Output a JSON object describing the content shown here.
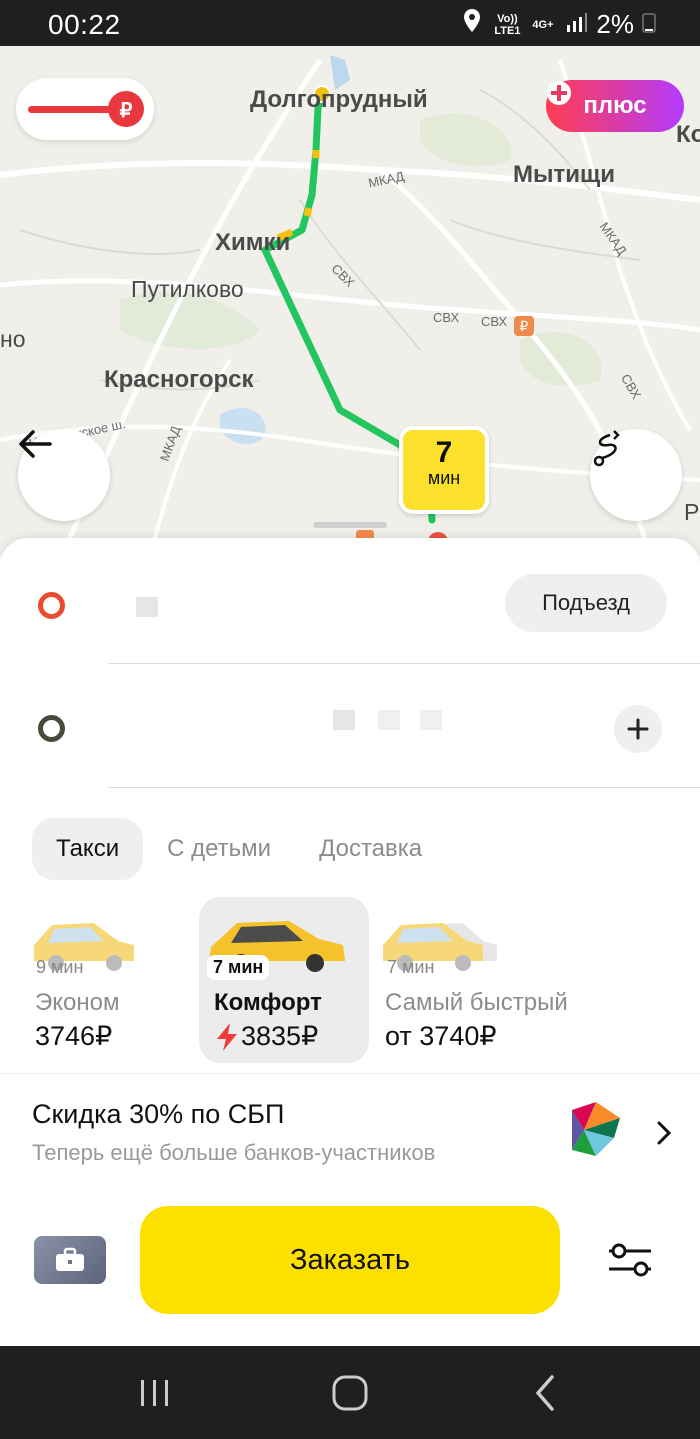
{
  "status_bar": {
    "time": "00:22",
    "network_top": "Vo)) LTE1",
    "network_type": "4G+",
    "battery": "2%"
  },
  "map": {
    "labels": [
      "Долгопрудный",
      "Мытищи",
      "Химки",
      "Путилково",
      "Красногорск",
      "МКАД",
      "МКАД",
      "МКАД",
      "СВХ",
      "СВХ",
      "СВХ",
      "СВХ",
      "Новорижское ш.",
      "Ко",
      "но",
      "Р"
    ],
    "plus_badge": "плюс",
    "eta": {
      "value": "7",
      "unit": "мин"
    },
    "colors": {
      "route": "#22c55e",
      "route_jam": "#f4c10f",
      "eta_bg": "#fbe12b"
    }
  },
  "route": {
    "from_button": "Подъезд",
    "add_stop_icon": "plus-icon"
  },
  "tabs": [
    {
      "label": "Такси",
      "active": true
    },
    {
      "label": "С детьми",
      "active": false
    },
    {
      "label": "Доставка",
      "active": false
    }
  ],
  "tariffs": [
    {
      "time": "9 мин",
      "name": "Эконом",
      "price": "3746₽",
      "selected": false
    },
    {
      "time": "7 мин",
      "name": "Комфорт",
      "price": "3835₽",
      "selected": true,
      "surge_icon": "lightning-icon"
    },
    {
      "time": "7 мин",
      "name": "Самый быстрый",
      "price": "от 3740₽",
      "selected": false
    }
  ],
  "promo": {
    "title": "Скидка 30% по СБП",
    "subtitle": "Теперь ещё больше банков-участников"
  },
  "order": {
    "button": "Заказать",
    "color": "#fce000"
  }
}
